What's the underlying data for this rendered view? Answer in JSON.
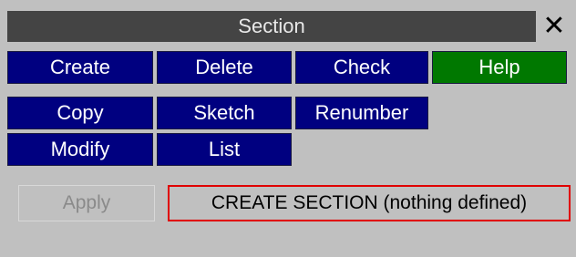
{
  "window": {
    "title": "Section",
    "close_glyph": "✕",
    "close_icon": "close-icon"
  },
  "buttons": {
    "create": "Create",
    "delete": "Delete",
    "check": "Check",
    "help": "Help",
    "copy": "Copy",
    "sketch": "Sketch",
    "renumber": "Renumber",
    "modify": "Modify",
    "list": "List"
  },
  "footer": {
    "apply_label": "Apply",
    "status_text": "CREATE SECTION (nothing defined)"
  },
  "colors": {
    "panel_bg": "#c0c0c0",
    "titlebar_bg": "#444444",
    "button_blue": "#000080",
    "button_green": "#007800",
    "status_border": "#e00000",
    "disabled_text": "#8a8a8a"
  }
}
